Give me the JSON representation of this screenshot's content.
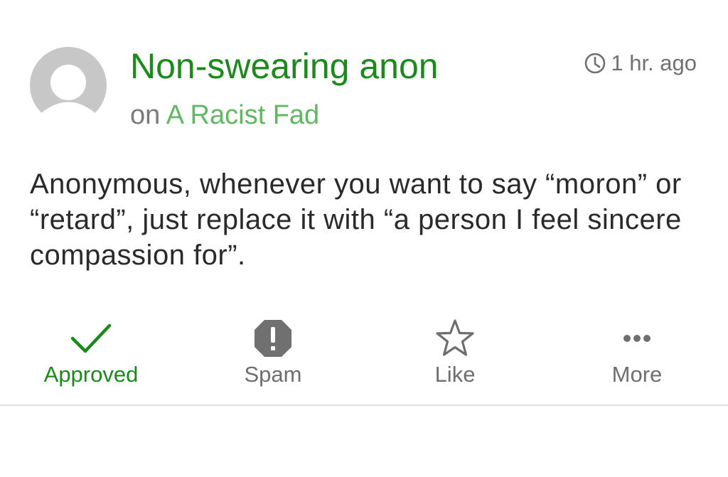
{
  "comment": {
    "author": "Non-swearing anon",
    "context_prefix": "on",
    "post_title": "A Racist Fad",
    "time": "1 hr. ago",
    "body": "Anonymous, whenever you want to say “moron” or “retard”, just replace it with “a person I feel sincere compassion for”."
  },
  "actions": [
    {
      "label": "Approved",
      "icon": "check-icon",
      "color": "#1a8a1a"
    },
    {
      "label": "Spam",
      "icon": "spam-icon",
      "color": "#6e6e6e"
    },
    {
      "label": "Like",
      "icon": "star-icon",
      "color": "#6e6e6e"
    },
    {
      "label": "More",
      "icon": "more-icon",
      "color": "#6e6e6e"
    }
  ],
  "colors": {
    "accent": "#1a8a1a",
    "link": "#62b862",
    "muted": "#7a7a7a",
    "avatar": "#c7c7c7"
  }
}
